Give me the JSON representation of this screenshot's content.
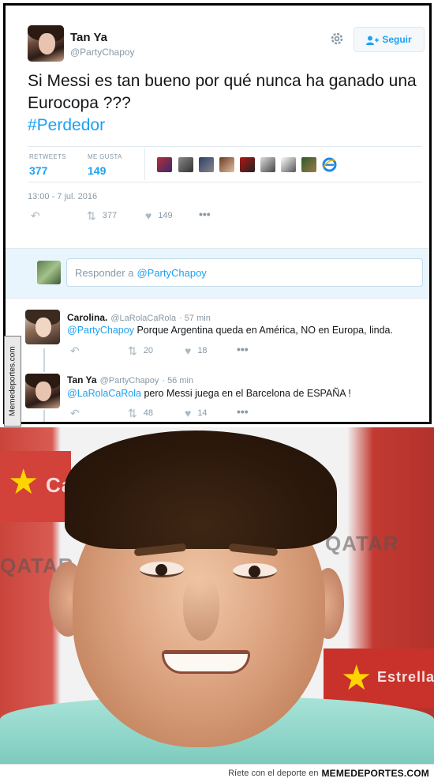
{
  "tweet": {
    "author_name": "Tan Ya",
    "author_handle": "@PartyChapoy",
    "follow_label": "Seguir",
    "text": "Si Messi es tan bueno por qué nunca ha ganado una Eurocopa ???",
    "hashtag": "#Perdedor",
    "stats": {
      "retweets_label": "RETWEETS",
      "retweets_value": "377",
      "likes_label": "ME GUSTA",
      "likes_value": "149"
    },
    "timestamp": "13:00 - 7 jul. 2016",
    "actions": {
      "retweet_count": "377",
      "like_count": "149"
    }
  },
  "reply_box": {
    "placeholder_prefix": "Responder a",
    "placeholder_mention": "@PartyChapoy"
  },
  "replies": [
    {
      "name": "Carolina.",
      "handle": "@LaRolaCaRola",
      "time": "· 57 min",
      "mention": "@PartyChapoy",
      "text": "Porque Argentina queda en América, NO en Europa, linda.",
      "retweets": "20",
      "likes": "18"
    },
    {
      "name": "Tan Ya",
      "handle": "@PartyChapoy",
      "time": "· 56 min",
      "mention": "@LaRolaCaRola",
      "text": "pero Messi juega en el Barcelona de ESPAÑA !",
      "retweets": "48",
      "likes": "14"
    }
  ],
  "watermark_vertical": "Memedeportes.com",
  "photo_sponsors": [
    "Ca",
    "QATAR",
    "Estrella"
  ],
  "footer": {
    "tagline": "Ríete con el deporte en",
    "brand": "MEMEDEPORTES.COM"
  },
  "colors": {
    "accent": "#1da1f2",
    "muted": "#8899a6",
    "text": "#14171a"
  }
}
